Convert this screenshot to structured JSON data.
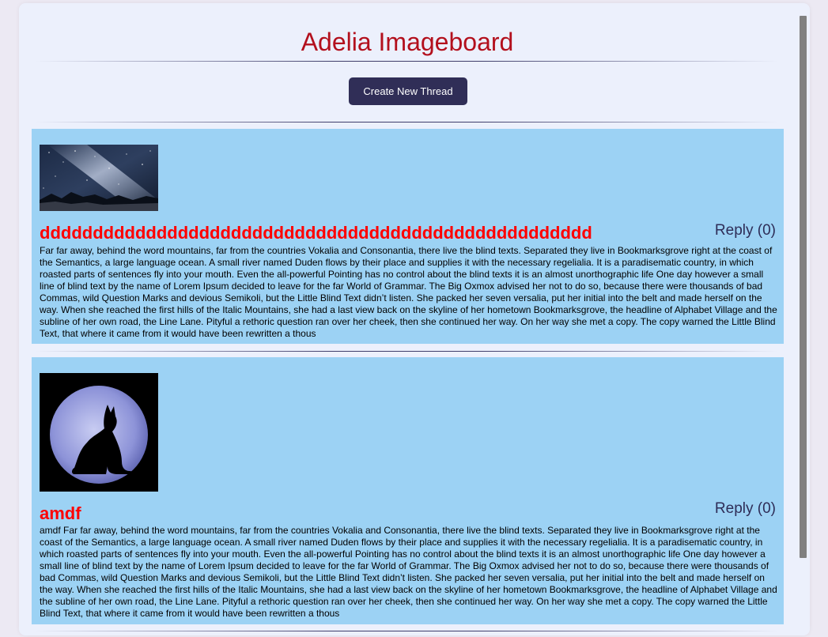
{
  "app": {
    "title": "Adelia Imageboard"
  },
  "toolbar": {
    "create_label": "Create New Thread"
  },
  "threads": [
    {
      "title": "dddddddddddddddddddddddddddddddddddddddddddddddddddd",
      "reply_label": "Reply (0)",
      "image": "night-sky-milky-way",
      "body": "Far far away, behind the word mountains, far from the countries Vokalia and Consonantia, there live the blind texts. Separated they live in Bookmarksgrove right at the coast of the Semantics, a large language ocean. A small river named Duden flows by their place and supplies it with the necessary regelialia. It is a paradisematic country, in which roasted parts of sentences fly into your mouth. Even the all-powerful Pointing has no control about the blind texts it is an almost unorthographic life One day however a small line of blind text by the name of Lorem Ipsum decided to leave for the far World of Grammar. The Big Oxmox advised her not to do so, because there were thousands of bad Commas, wild Question Marks and devious Semikoli, but the Little Blind Text didn’t listen. She packed her seven versalia, put her initial into the belt and made herself on the way. When she reached the first hills of the Italic Mountains, she had a last view back on the skyline of her hometown Bookmarksgrove, the headline of Alphabet Village and the subline of her own road, the Line Lane. Pityful a rethoric question ran over her cheek, then she continued her way. On her way she met a copy. The copy warned the Little Blind Text, that where it came from it would have been rewritten a thous"
    },
    {
      "title": "amdf",
      "reply_label": "Reply (0)",
      "image": "cat-silhouette-moon",
      "body": "amdf Far far away, behind the word mountains, far from the countries Vokalia and Consonantia, there live the blind texts. Separated they live in Bookmarksgrove right at the coast of the Semantics, a large language ocean. A small river named Duden flows by their place and supplies it with the necessary regelialia. It is a paradisematic country, in which roasted parts of sentences fly into your mouth. Even the all-powerful Pointing has no control about the blind texts it is an almost unorthographic life One day however a small line of blind text by the name of Lorem Ipsum decided to leave for the far World of Grammar. The Big Oxmox advised her not to do so, because there were thousands of bad Commas, wild Question Marks and devious Semikoli, but the Little Blind Text didn’t listen. She packed her seven versalia, put her initial into the belt and made herself on the way. When she reached the first hills of the Italic Mountains, she had a last view back on the skyline of her hometown Bookmarksgrove, the headline of Alphabet Village and the subline of her own road, the Line Lane. Pityful a rethoric question ran over her cheek, then she continued her way. On her way she met a copy. The copy warned the Little Blind Text, that where it came from it would have been rewritten a thous"
    }
  ],
  "colors": {
    "title": "#b3101d",
    "button": "#302e57",
    "thread_bg": "#9cd2f4",
    "thread_title": "#ff0000",
    "reply": "#2e2d57"
  }
}
